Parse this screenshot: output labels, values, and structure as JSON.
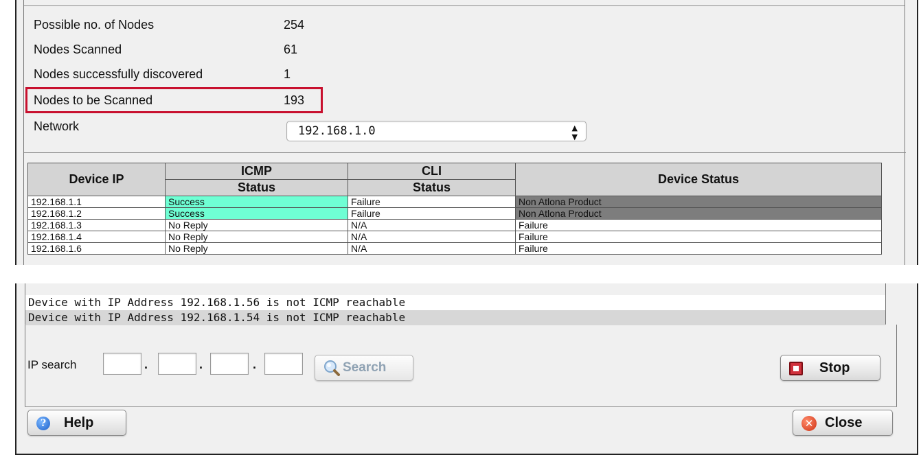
{
  "scan_summary": {
    "possible_nodes_label": "Possible no. of Nodes",
    "possible_nodes_value": "254",
    "nodes_scanned_label": "Nodes Scanned",
    "nodes_scanned_value": "61",
    "nodes_discovered_label": "Nodes successfully discovered",
    "nodes_discovered_value": "1",
    "nodes_to_scan_label": "Nodes to be Scanned",
    "nodes_to_scan_value": "193",
    "network_label": "Network",
    "network_selected": "192.168.1.0"
  },
  "device_table": {
    "headers": {
      "device_ip": "Device IP",
      "icmp": "ICMP",
      "icmp_status": "Status",
      "cli": "CLI",
      "cli_status": "Status",
      "device_status": "Device Status"
    },
    "rows": [
      {
        "ip": "192.168.1.1",
        "icmp": "Success",
        "cli": "Failure",
        "device": "Non Atlona Product"
      },
      {
        "ip": "192.168.1.2",
        "icmp": "Success",
        "cli": "Failure",
        "device": "Non Atlona Product"
      },
      {
        "ip": "192.168.1.3",
        "icmp": "No Reply",
        "cli": "N/A",
        "device": "Failure"
      },
      {
        "ip": "192.168.1.4",
        "icmp": "No Reply",
        "cli": "N/A",
        "device": "Failure"
      },
      {
        "ip": "192.168.1.6",
        "icmp": "No Reply",
        "cli": "N/A",
        "device": "Failure"
      }
    ]
  },
  "log": {
    "lines": [
      "Device with IP Address 192.168.1.56 is not ICMP reachable",
      "Device with IP Address 192.168.1.54 is not ICMP reachable"
    ]
  },
  "ip_search": {
    "label": "IP search",
    "octet_values": [
      "",
      "",
      "",
      ""
    ],
    "separator": ".",
    "search_button": "Search"
  },
  "buttons": {
    "stop": "Stop",
    "help": "Help",
    "close": "Close"
  },
  "colors": {
    "highlight": "#c8102e",
    "success_cell": "#6fffd4",
    "non_atlona_cell": "#7d7d7d"
  },
  "icons": {
    "search": "magnifier-icon",
    "stop": "stop-icon",
    "help": "help-icon",
    "close": "close-icon"
  }
}
